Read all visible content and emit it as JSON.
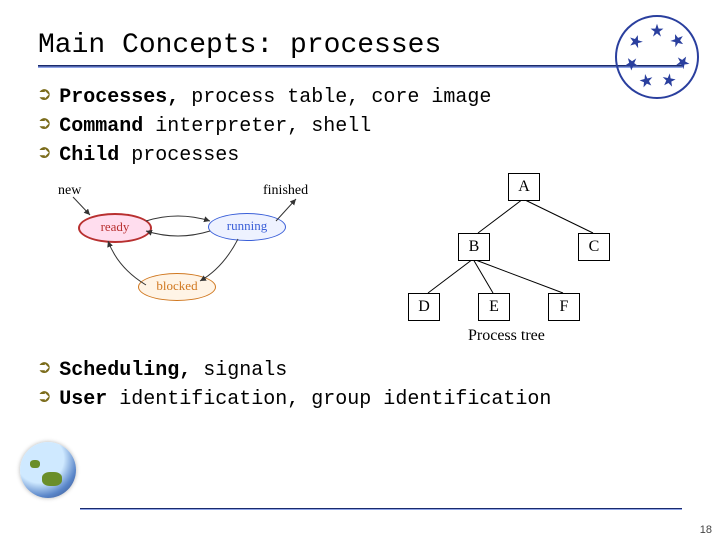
{
  "title": "Main Concepts: processes",
  "bullets": [
    {
      "lead": "Processes,",
      "rest": " process table, core image"
    },
    {
      "lead": "Command",
      "rest": " interpreter, shell"
    },
    {
      "lead": "Child",
      "rest": " processes"
    },
    {
      "lead": "Scheduling,",
      "rest": " signals"
    },
    {
      "lead": "User",
      "rest": " identification, group identification"
    }
  ],
  "state_diagram": {
    "new_label": "new",
    "finished_label": "finished",
    "states": {
      "ready": "ready",
      "running": "running",
      "blocked": "blocked"
    }
  },
  "process_tree": {
    "nodes": {
      "A": "A",
      "B": "B",
      "C": "C",
      "D": "D",
      "E": "E",
      "F": "F"
    },
    "caption": "Process tree"
  },
  "page_number": "18"
}
